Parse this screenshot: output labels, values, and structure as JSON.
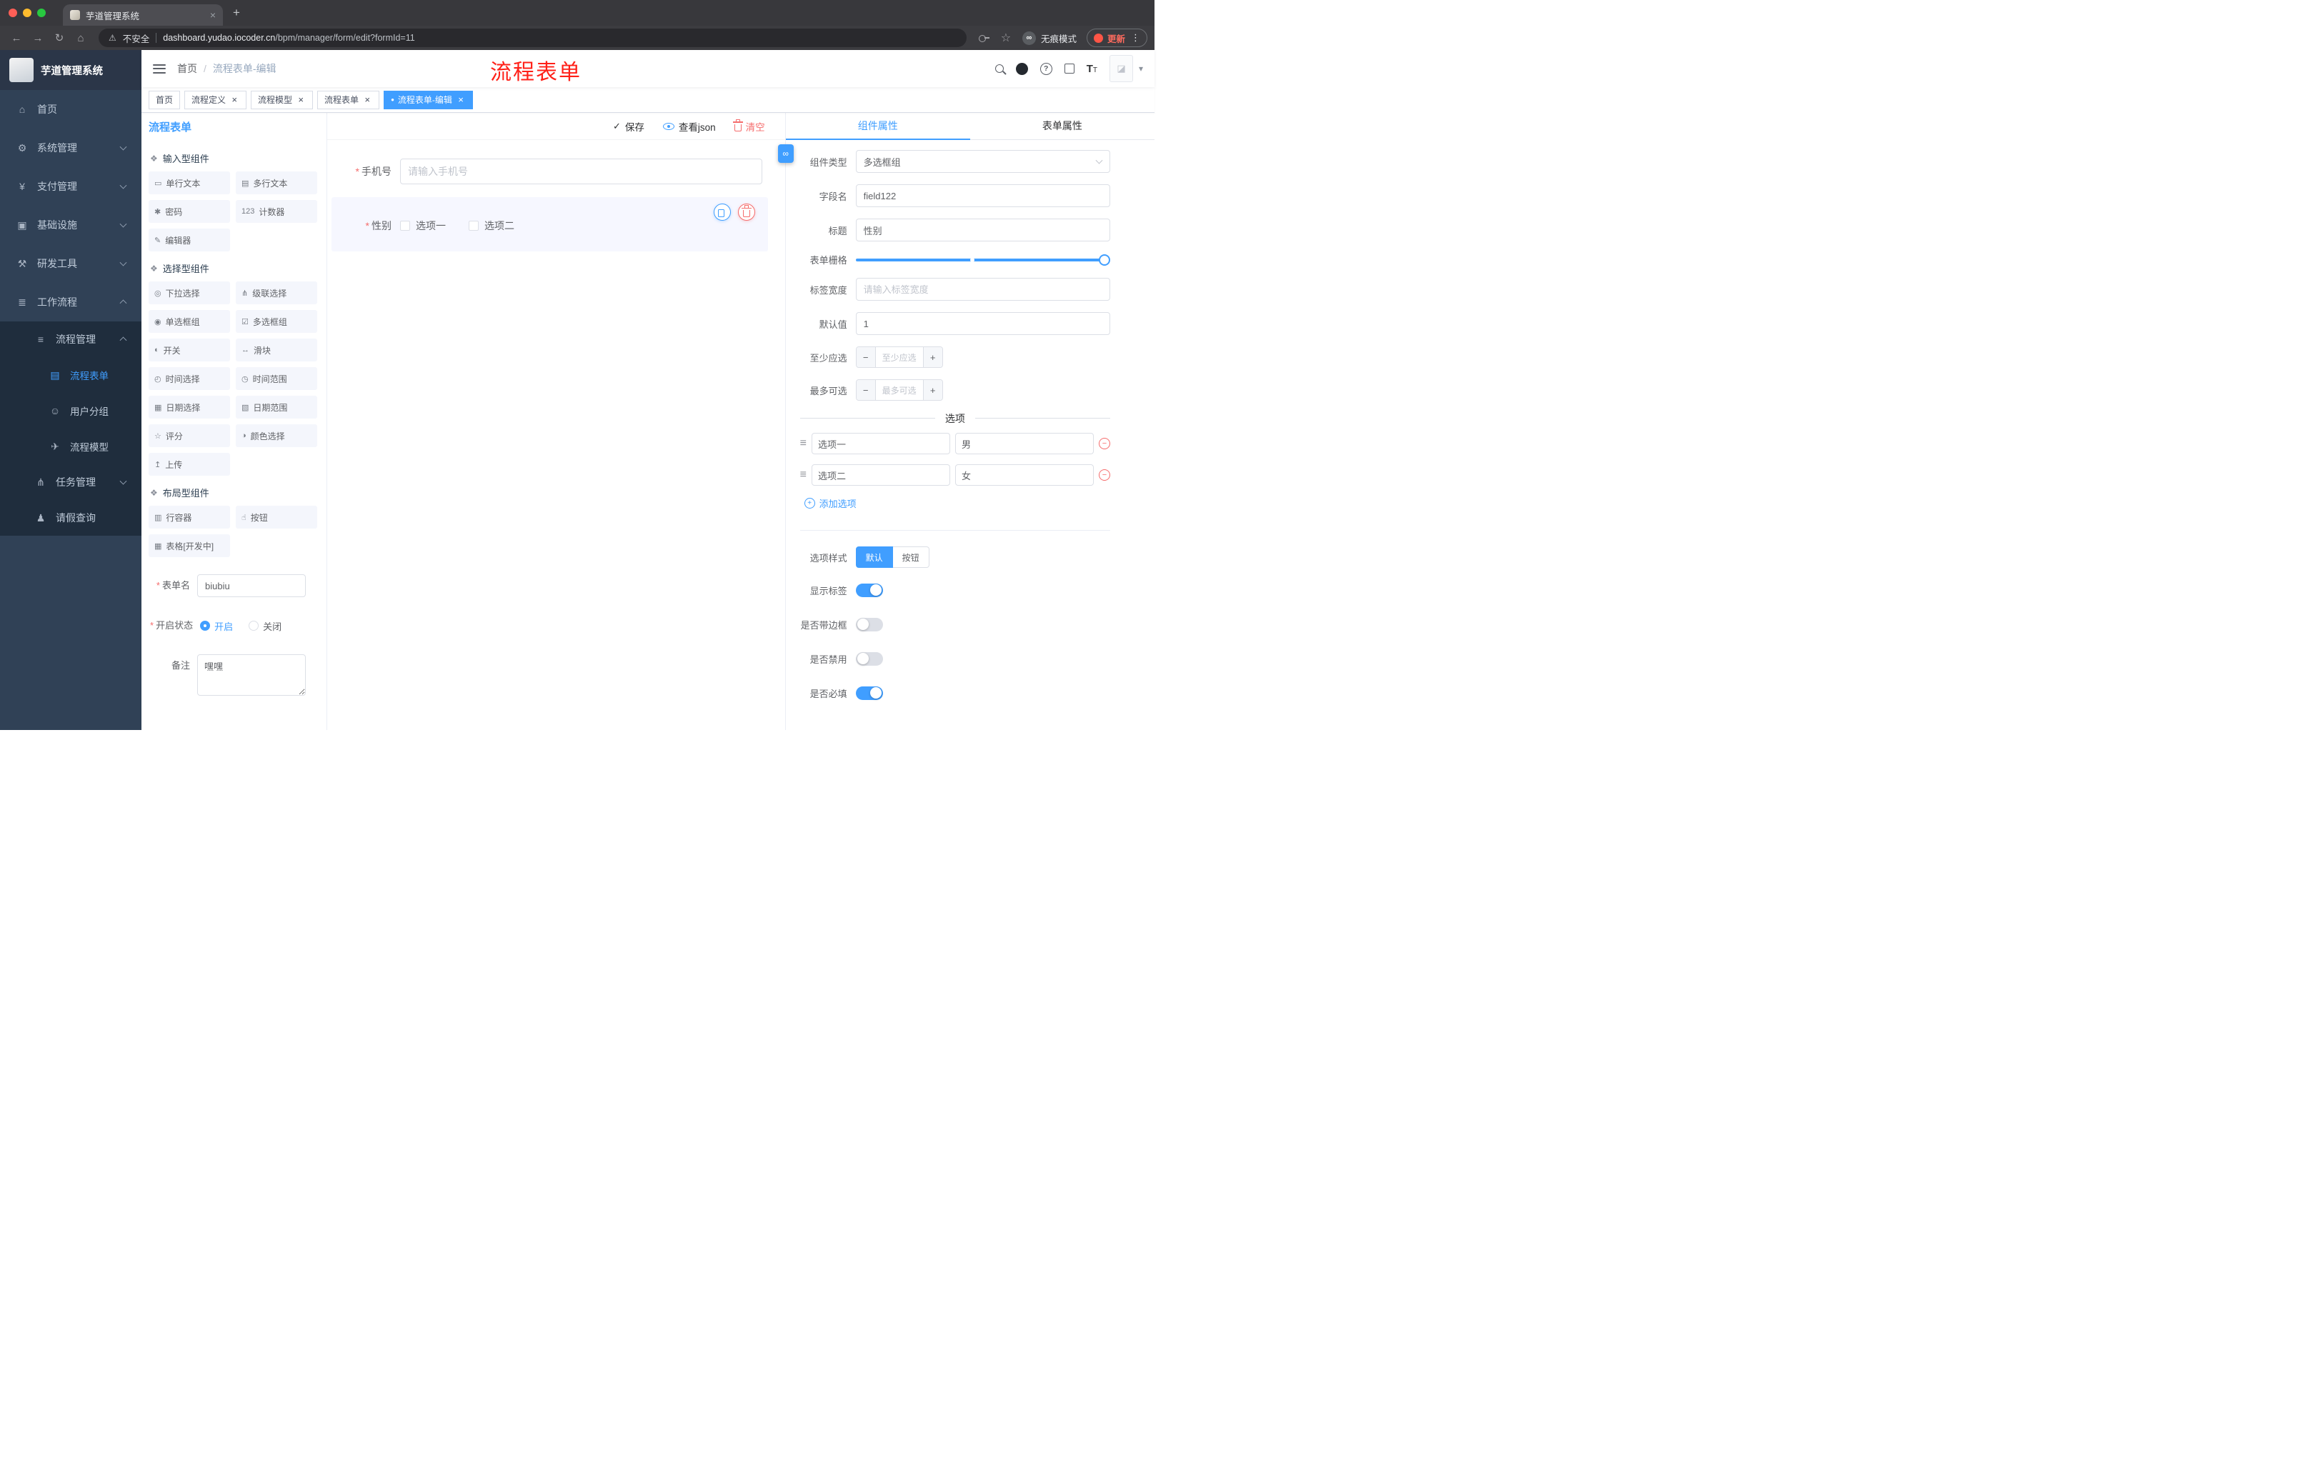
{
  "colors": {
    "primary": "#409EFF",
    "danger": "#F56C6C",
    "sidebar": "#304156",
    "sidebar_submenu": "#1F2D3D",
    "annotation": "#FF2018"
  },
  "glyphs": {
    "back": "←",
    "forward": "→",
    "reload": "↻",
    "home": "⌂",
    "warning": "⚠",
    "star": "☆",
    "incognito": "∞",
    "dots": "⋮",
    "new_tab": "+",
    "close": "×",
    "caret_down": "▾",
    "check": "✓",
    "link": "∞",
    "drag": "≡",
    "minus": "−",
    "plus": "+",
    "question": "?",
    "font_size_big": "T",
    "font_size_small": "T",
    "image_placeholder": "◪"
  },
  "browser": {
    "tab": {
      "title": "芋道管理系统"
    },
    "address": {
      "security_label": "不安全",
      "host": "dashboard.yudao.iocoder.cn",
      "path": "/bpm/manager/form/edit?formId=11"
    },
    "incognito_label": "无痕模式",
    "update_label": "更新"
  },
  "sidebar": {
    "logo_title": "芋道管理系统",
    "menu": [
      {
        "label": "首页",
        "icon": "dashboard-icon",
        "glyph": "⌂",
        "cls": "lvl1"
      },
      {
        "label": "系统管理",
        "icon": "gear-icon",
        "glyph": "⚙",
        "cls": "lvl1 arr down"
      },
      {
        "label": "支付管理",
        "icon": "yuan-icon",
        "glyph": "¥",
        "cls": "lvl1 arr down"
      },
      {
        "label": "基础设施",
        "icon": "monitor-icon",
        "glyph": "▣",
        "cls": "lvl1 arr down"
      },
      {
        "label": "研发工具",
        "icon": "tools-icon",
        "glyph": "⚒",
        "cls": "lvl1 arr down"
      },
      {
        "label": "工作流程",
        "icon": "workflow-icon",
        "glyph": "≣",
        "cls": "lvl1 arr up"
      },
      {
        "label": "流程管理",
        "icon": "list-icon",
        "glyph": "≡",
        "cls": "lvl2 dark arr up"
      },
      {
        "label": "流程表单",
        "icon": "document-icon",
        "glyph": "▤",
        "cls": "lvl3 dark active"
      },
      {
        "label": "用户分组",
        "icon": "users-icon",
        "glyph": "☺",
        "cls": "lvl3 dark"
      },
      {
        "label": "流程模型",
        "icon": "send-icon",
        "glyph": "✈",
        "cls": "lvl3 dark"
      },
      {
        "label": "任务管理",
        "icon": "branch-icon",
        "glyph": "⋔",
        "cls": "lvl2 dark arr down"
      },
      {
        "label": "请假查询",
        "icon": "person-icon",
        "glyph": "♟",
        "cls": "lvl2 dark"
      }
    ]
  },
  "navbar": {
    "breadcrumb": {
      "first": "首页",
      "separator": "/",
      "last": "流程表单-编辑"
    },
    "annotation": "流程表单"
  },
  "tags": [
    {
      "label": "首页",
      "cls": "",
      "dot": "",
      "close": ""
    },
    {
      "label": "流程定义",
      "cls": "",
      "dot": "",
      "close": "×"
    },
    {
      "label": "流程模型",
      "cls": "",
      "dot": "",
      "close": "×"
    },
    {
      "label": "流程表单",
      "cls": "",
      "dot": "",
      "close": "×"
    },
    {
      "label": "流程表单-编辑",
      "cls": "active",
      "dot": "●",
      "close": "×"
    }
  ],
  "designer": {
    "title": "流程表单",
    "actions": {
      "save": "保存",
      "view_json": "查看json",
      "clear": "清空"
    },
    "groups": [
      {
        "title": "输入型组件",
        "icon": "components-group-icon",
        "glyph": "❖",
        "items": [
          {
            "label": "单行文本",
            "icon": "single-line-icon",
            "glyph": "▭"
          },
          {
            "label": "多行文本",
            "icon": "multi-line-icon",
            "glyph": "▤"
          },
          {
            "label": "密码",
            "icon": "password-icon",
            "glyph": "✱"
          },
          {
            "label": "计数器",
            "icon": "counter-icon",
            "glyph": "123"
          },
          {
            "label": "编辑器",
            "icon": "editor-icon",
            "glyph": "✎"
          }
        ]
      },
      {
        "title": "选择型组件",
        "icon": "components-group-icon",
        "glyph": "❖",
        "items": [
          {
            "label": "下拉选择",
            "icon": "select-icon",
            "glyph": "◎"
          },
          {
            "label": "级联选择",
            "icon": "cascade-icon",
            "glyph": "⋔"
          },
          {
            "label": "单选框组",
            "icon": "radio-group-icon",
            "glyph": "◉"
          },
          {
            "label": "多选框组",
            "icon": "checkbox-group-icon",
            "glyph": "☑"
          },
          {
            "label": "开关",
            "icon": "switch-icon",
            "glyph": "◐"
          },
          {
            "label": "滑块",
            "icon": "slider-icon",
            "glyph": "↔"
          },
          {
            "label": "时间选择",
            "icon": "time-icon",
            "glyph": "◴"
          },
          {
            "label": "时间范围",
            "icon": "time-range-icon",
            "glyph": "◷"
          },
          {
            "label": "日期选择",
            "icon": "date-icon",
            "glyph": "▦"
          },
          {
            "label": "日期范围",
            "icon": "date-range-icon",
            "glyph": "▧"
          },
          {
            "label": "评分",
            "icon": "rate-icon",
            "glyph": "☆"
          },
          {
            "label": "颜色选择",
            "icon": "color-icon",
            "glyph": "◑"
          },
          {
            "label": "上传",
            "icon": "upload-icon",
            "glyph": "↥"
          }
        ]
      },
      {
        "title": "布局型组件",
        "icon": "components-group-icon",
        "glyph": "❖",
        "items": [
          {
            "label": "行容器",
            "icon": "row-container-icon",
            "glyph": "▥"
          },
          {
            "label": "按钮",
            "icon": "button-icon",
            "glyph": "☝"
          },
          {
            "label": "表格[开发中]",
            "icon": "table-icon",
            "glyph": "▦"
          }
        ]
      }
    ],
    "meta": {
      "form_name_label": "表单名",
      "form_name_value": "biubiu",
      "status_label": "开启状态",
      "status_on": "开启",
      "status_off": "关闭",
      "remark_label": "备注",
      "remark_value": "嘿嘿"
    },
    "canvas": {
      "phone": {
        "label": "手机号",
        "placeholder": "请输入手机号"
      },
      "gender": {
        "label": "性别",
        "option1": "选项一",
        "option2": "选项二"
      }
    }
  },
  "props": {
    "tabs": {
      "component": "组件属性",
      "form": "表单属性"
    },
    "component_type": {
      "label": "组件类型",
      "value": "多选框组"
    },
    "field_name": {
      "label": "字段名",
      "value": "field122"
    },
    "title": {
      "label": "标题",
      "value": "性别"
    },
    "grid": {
      "label": "表单栅格"
    },
    "label_width": {
      "label": "标签宽度",
      "placeholder": "请输入标签宽度"
    },
    "default_value": {
      "label": "默认值",
      "value": "1"
    },
    "min_select": {
      "label": "至少应选",
      "placeholder": "至少应选"
    },
    "max_select": {
      "label": "最多可选",
      "placeholder": "最多可选"
    },
    "options_title": "选项",
    "options": [
      {
        "name": "选项一",
        "value": "男"
      },
      {
        "name": "选项二",
        "value": "女"
      }
    ],
    "add_option_label": "添加选项",
    "option_style": {
      "label": "选项样式",
      "options": [
        "默认",
        "按钮"
      ],
      "active": "默认"
    },
    "switches": [
      {
        "label": "显示标签",
        "cls": "on"
      },
      {
        "label": "是否带边框",
        "cls": ""
      },
      {
        "label": "是否禁用",
        "cls": ""
      },
      {
        "label": "是否必填",
        "cls": "on"
      }
    ]
  }
}
